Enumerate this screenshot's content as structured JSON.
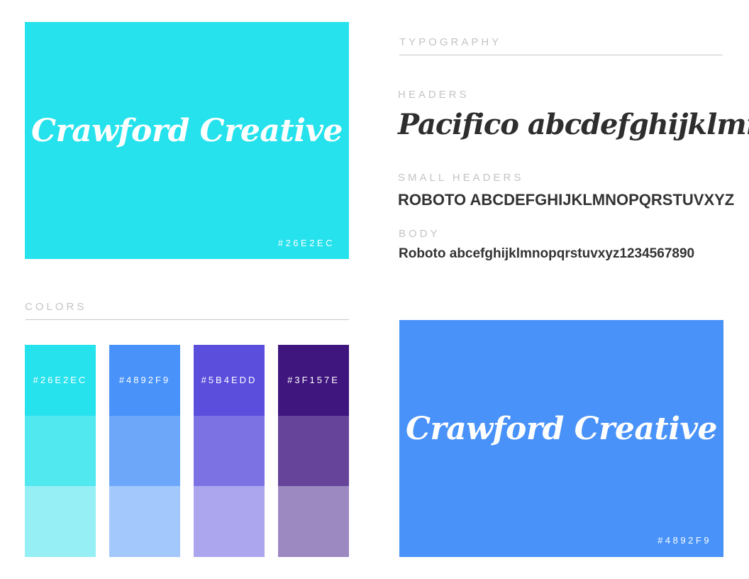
{
  "brand_card_primary": {
    "name": "Crawford Creative",
    "hex": "#26E2EC",
    "color": "#26E2EC"
  },
  "brand_card_secondary": {
    "name": "Crawford Creative",
    "hex": "#4892F9",
    "color": "#4892F9"
  },
  "typography": {
    "title": "TYPOGRAPHY",
    "headers_label": "HEADERS",
    "headers_sample": "Pacifico abcdefghijklmno",
    "small_headers_label": "SMALL HEADERS",
    "small_headers_sample": "ROBOTO ABCDEFGHIJKLMNOPQRSTUVXYZ",
    "body_label": "BODY",
    "body_sample": "Roboto abcefghijklmnopqrstuvxyz1234567890"
  },
  "colors": {
    "title": "COLORS",
    "palette": [
      {
        "hex": "#26E2EC",
        "shades": [
          "#26E2EC",
          "#51E8F0",
          "#96EFF4"
        ]
      },
      {
        "hex": "#4892F9",
        "shades": [
          "#4892F9",
          "#6CA7FA",
          "#A3C8FC"
        ]
      },
      {
        "hex": "#5B4EDD",
        "shades": [
          "#5B4EDD",
          "#7C72E4",
          "#ACA6EE"
        ]
      },
      {
        "hex": "#3F157E",
        "shades": [
          "#3F157E",
          "#65449A",
          "#9D89C1"
        ]
      }
    ]
  }
}
